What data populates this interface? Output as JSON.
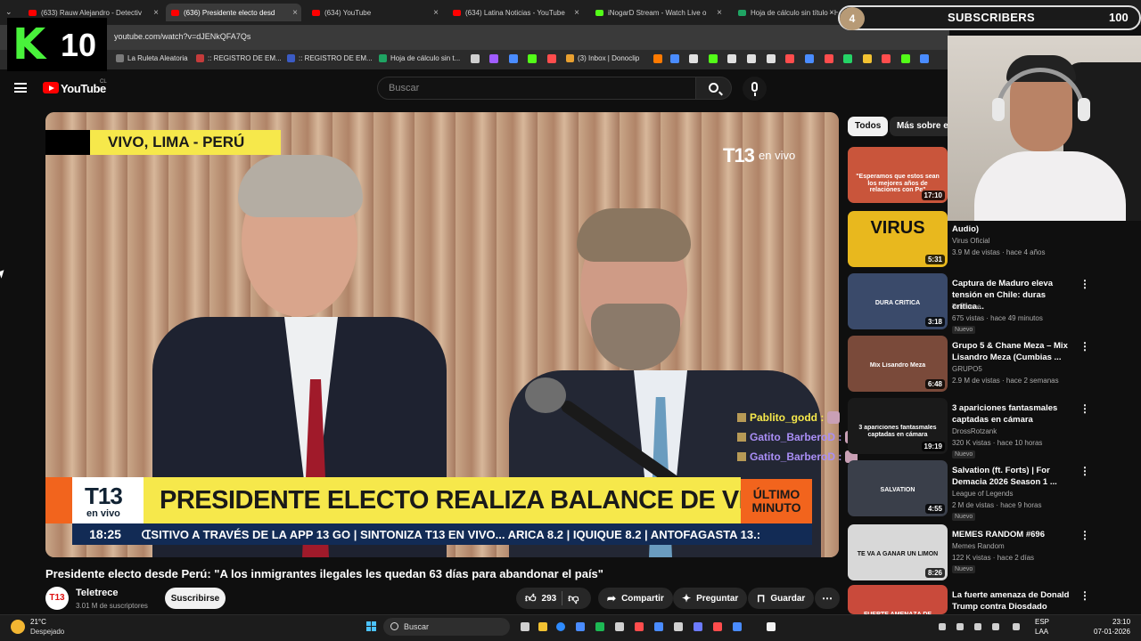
{
  "browser": {
    "tabs": [
      {
        "label": "(633) Rauw Alejandro - Detectiv",
        "color": "#ff0000",
        "active": false
      },
      {
        "label": "(636) Presidente electo desd",
        "color": "#ff0000",
        "active": true
      },
      {
        "label": "(634) YouTube",
        "color": "#ff0000",
        "active": false
      },
      {
        "label": "(634) Latina Noticias - YouTube",
        "color": "#ff0000",
        "active": false
      },
      {
        "label": "iNogarD Stream - Watch Live o",
        "color": "#53fc18",
        "active": false
      },
      {
        "label": "Hoja de cálculo sin título - H",
        "color": "#1fa463",
        "active": false
      }
    ],
    "url": "youtube.com/watch?v=dJENkQFA7Qs",
    "bookmarks": [
      {
        "label": "La Ruleta Aleatoria",
        "color": "#7a7a7a"
      },
      {
        "label": ":: REGISTRO DE EM...",
        "color": "#c43b3b"
      },
      {
        "label": ":: REGISTRO DE EM...",
        "color": "#3b5bc4"
      },
      {
        "label": "Hoja de cálculo sin t...",
        "color": "#1fa463"
      },
      {
        "label": "(3) Inbox | Donoclip",
        "color": "#e8a030"
      }
    ]
  },
  "overlay": {
    "logo_k": "K",
    "logo_num": "10",
    "sub_current": "4",
    "sub_label": "SUBSCRIBERS",
    "sub_goal": "100"
  },
  "youtube": {
    "logo_text": "YouTube",
    "logo_country": "CL",
    "search_placeholder": "Buscar"
  },
  "video": {
    "banner_top": "VIVO, LIMA - PERÚ",
    "t13_top": "T13",
    "t13_top_sub": "en vivo",
    "lower_logo_a": "T13",
    "lower_logo_b": "en vivo",
    "headline": "PRESIDENTE ELECTO REALIZA BALANCE DE VIAJE A PERÚ",
    "badge_line1": "ÚLTIMO",
    "badge_line2": "MINUTO",
    "ticker_time": "18:25",
    "ticker_text": "ᗭSITIVO A TRAVÉS DE LA APP 13 GO    |    SINTONIZA T13 EN VIVO... ARICA 8.2  |  IQUIQUE 8.2  |  ANTOFAGASTA 13.:",
    "chat": [
      {
        "user": "Pablito_godd :",
        "color": "#f6e84b"
      },
      {
        "user": "Gatito_BarberoD :",
        "color": "#a98ef5"
      },
      {
        "user": "Gatito_BarberoD :",
        "color": "#a98ef5"
      }
    ],
    "title": "Presidente electo desde Perú: \"A los inmigrantes ilegales les quedan 63 días para abandonar el país\"",
    "channel_avatar": "T13",
    "channel_name": "Teletrece",
    "channel_subs": "3.01 M de suscriptores",
    "subscribe_label": "Suscribirse",
    "likes": "293",
    "share_label": "Compartir",
    "ask_label": "Preguntar",
    "save_label": "Guardar"
  },
  "chips": {
    "all": "Todos",
    "more": "Más sobre es"
  },
  "recommendations": [
    {
      "title": "",
      "channel": "",
      "meta": "",
      "duration": "17:10",
      "thumb_text": "\"Esperamos que estos sean los mejores años de relaciones con Pe\"",
      "bg": "#c9553b"
    },
    {
      "title": "Audio)",
      "channel": "Virus Oficial",
      "meta": "3.9 M de vistas · hace 4 años",
      "duration": "5:31",
      "thumb_text": "VIRUS",
      "bg": "#e8b81e"
    },
    {
      "title": "Captura de Maduro eleva tensión en Chile: duras crítica...",
      "channel": "Teletrece",
      "meta": "675 vistas · hace 49 minutos",
      "new": "Nuevo",
      "duration": "3:18",
      "thumb_text": "DURA CRÍTICA",
      "bg": "#3a4a6a"
    },
    {
      "title": "Grupo 5 & Chane Meza – Mix Lisandro Meza (Cumbias ...",
      "channel": "GRUPO5",
      "meta": "2.9 M de vistas · hace 2 semanas",
      "duration": "6:48",
      "thumb_text": "Mix Lisandro Meza",
      "bg": "#7a4a3a"
    },
    {
      "title": "3 apariciones fantasmales captadas en cámara",
      "channel": "DrossRotzank",
      "meta": "320 K vistas · hace 10 horas",
      "new": "Nuevo",
      "duration": "19:19",
      "thumb_text": "3 apariciones fantasmales captadas en cámara",
      "bg": "#1a1a1a"
    },
    {
      "title": "Salvation (ft. Forts) | For Demacia 2026 Season 1 ...",
      "channel": "League of Legends",
      "meta": "2 M de vistas · hace 9 horas",
      "new": "Nuevo",
      "duration": "4:55",
      "thumb_text": "SALVATION",
      "bg": "#3a3f4a"
    },
    {
      "title": "MEMES RANDOM #696",
      "channel": "Memes Random",
      "meta": "122 K vistas · hace 2 días",
      "new": "Nuevo",
      "duration": "8:26",
      "thumb_text": "TE VA A GANAR UN LIMÓN",
      "bg": "#d8d8d8"
    },
    {
      "title": "La fuerte amenaza de Donald Trump contra Diosdado Cabell...",
      "channel": "",
      "meta": "",
      "duration": "",
      "thumb_text": "FUERTE AMENAZA DE",
      "bg": "#c94a3b"
    }
  ],
  "taskbar": {
    "temp": "21°C",
    "weather": "Despejado",
    "search": "Buscar",
    "lang1": "ESP",
    "lang2": "LAA",
    "time": "23:10",
    "date": "07-01-2026"
  }
}
